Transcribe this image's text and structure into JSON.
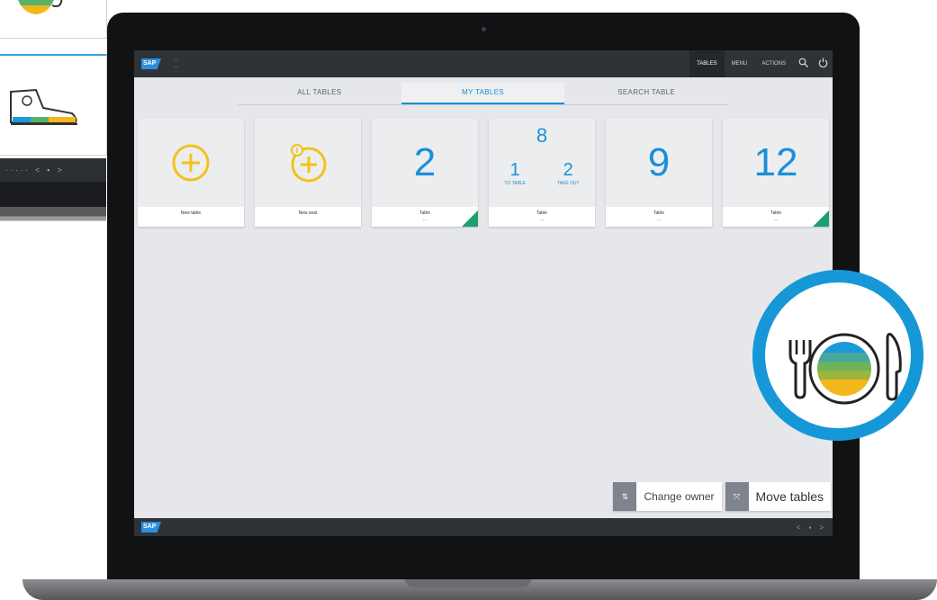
{
  "header": {
    "user_line1": "…",
    "user_line2": "…",
    "nav": [
      "TABLES",
      "MENU",
      "ACTIONS"
    ],
    "active_nav": "TABLES"
  },
  "tabs": [
    {
      "label": "ALL TABLES",
      "active": false
    },
    {
      "label": "MY TABLES",
      "active": true
    },
    {
      "label": "SEARCH TABLE",
      "active": false
    }
  ],
  "tiles": [
    {
      "type": "add",
      "label": "New table"
    },
    {
      "type": "add-seat",
      "label": "New seat"
    },
    {
      "type": "number",
      "number": "2",
      "label": "Table",
      "sub": "…",
      "flag": true
    },
    {
      "type": "split",
      "total": "8",
      "left_num": "1",
      "left_label": "TO TABLE",
      "right_num": "2",
      "right_label": "TAKE OUT",
      "label": "Table",
      "sub": "…",
      "flag": false
    },
    {
      "type": "number",
      "number": "9",
      "label": "Table",
      "sub": "…",
      "flag": false
    },
    {
      "type": "number",
      "number": "12",
      "label": "Table",
      "sub": "…",
      "flag": true
    }
  ],
  "actions": {
    "change_owner": "Change owner",
    "move_tables": "Move tables"
  },
  "colors": {
    "accent": "#1698d8",
    "tile_number": "#1c8fd8",
    "add_icon": "#f2c21b",
    "flag": "#1aa06b"
  },
  "icons": [
    "add-icon",
    "search-icon",
    "power-icon",
    "fork-icon",
    "plate-icon",
    "knife-icon",
    "shoe-icon",
    "cup-icon"
  ]
}
